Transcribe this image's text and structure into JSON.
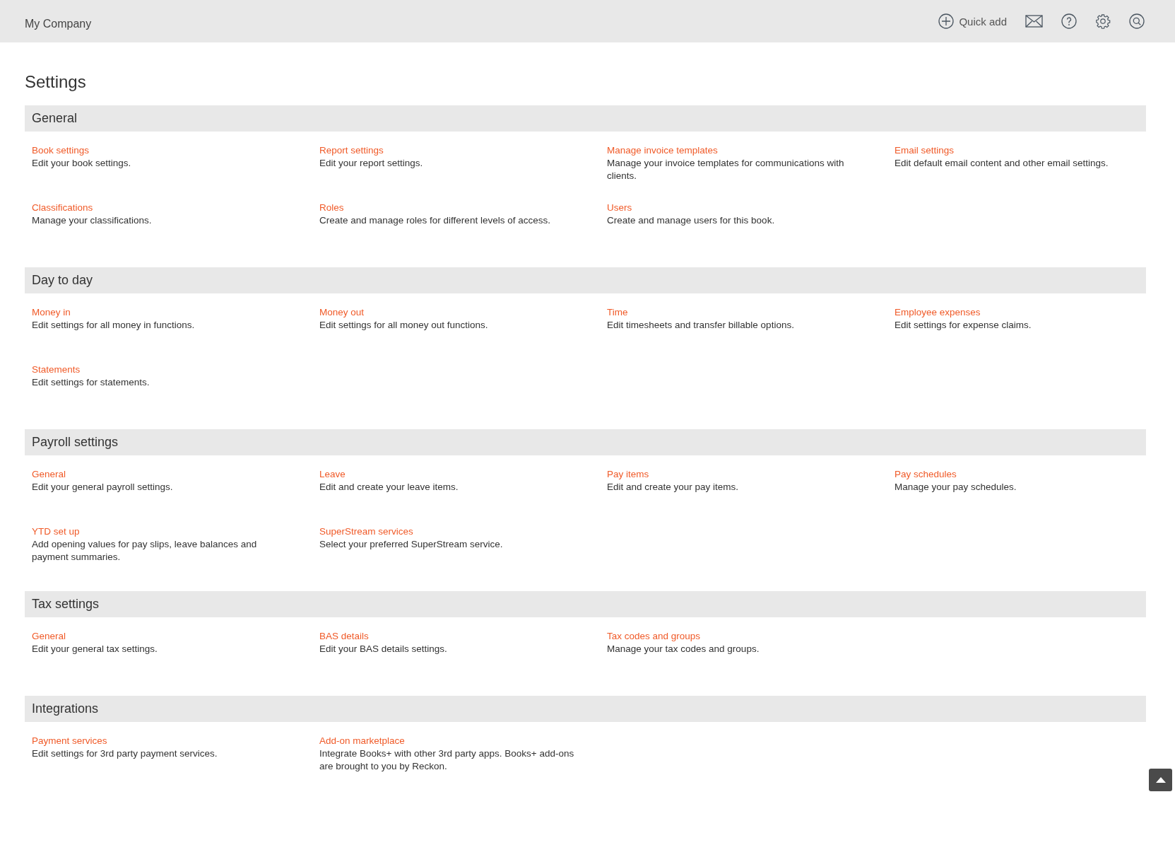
{
  "topbar": {
    "company": "My Company",
    "quick_add": "Quick add"
  },
  "title": "Settings",
  "sections": [
    {
      "heading": "General",
      "items": [
        {
          "title": "Book settings",
          "description": "Edit your book settings."
        },
        {
          "title": "Report settings",
          "description": "Edit your report settings."
        },
        {
          "title": "Manage invoice templates",
          "description": "Manage your invoice templates for communications with clients."
        },
        {
          "title": "Email settings",
          "description": "Edit default email content and other email settings."
        },
        {
          "title": "Classifications",
          "description": "Manage your classifications."
        },
        {
          "title": "Roles",
          "description": "Create and manage roles for different levels of access."
        },
        {
          "title": "Users",
          "description": "Create and manage users for this book."
        }
      ]
    },
    {
      "heading": "Day to day",
      "items": [
        {
          "title": "Money in",
          "description": "Edit settings for all money in functions."
        },
        {
          "title": "Money out",
          "description": "Edit settings for all money out functions."
        },
        {
          "title": "Time",
          "description": "Edit timesheets and transfer billable options."
        },
        {
          "title": "Employee expenses",
          "description": "Edit settings for expense claims."
        },
        {
          "title": "Statements",
          "description": "Edit settings for statements."
        }
      ]
    },
    {
      "heading": "Payroll settings",
      "items": [
        {
          "title": "General",
          "description": "Edit your general payroll settings."
        },
        {
          "title": "Leave",
          "description": "Edit and create your leave items."
        },
        {
          "title": "Pay items",
          "description": "Edit and create your pay items."
        },
        {
          "title": "Pay schedules",
          "description": "Manage your pay schedules."
        },
        {
          "title": "YTD set up",
          "description": "Add opening values for pay slips, leave balances and payment summaries."
        },
        {
          "title": "SuperStream services",
          "description": "Select your preferred SuperStream service."
        }
      ]
    },
    {
      "heading": "Tax settings",
      "items": [
        {
          "title": "General",
          "description": "Edit your general tax settings."
        },
        {
          "title": "BAS details",
          "description": "Edit your BAS details settings."
        },
        {
          "title": "Tax codes and groups",
          "description": "Manage your tax codes and groups."
        }
      ]
    },
    {
      "heading": "Integrations",
      "items": [
        {
          "title": "Payment services",
          "description": "Edit settings for 3rd party payment services."
        },
        {
          "title": "Add-on marketplace",
          "description": "Integrate Books+ with other 3rd party apps. Books+ add-ons are brought to you by Reckon."
        }
      ]
    }
  ]
}
